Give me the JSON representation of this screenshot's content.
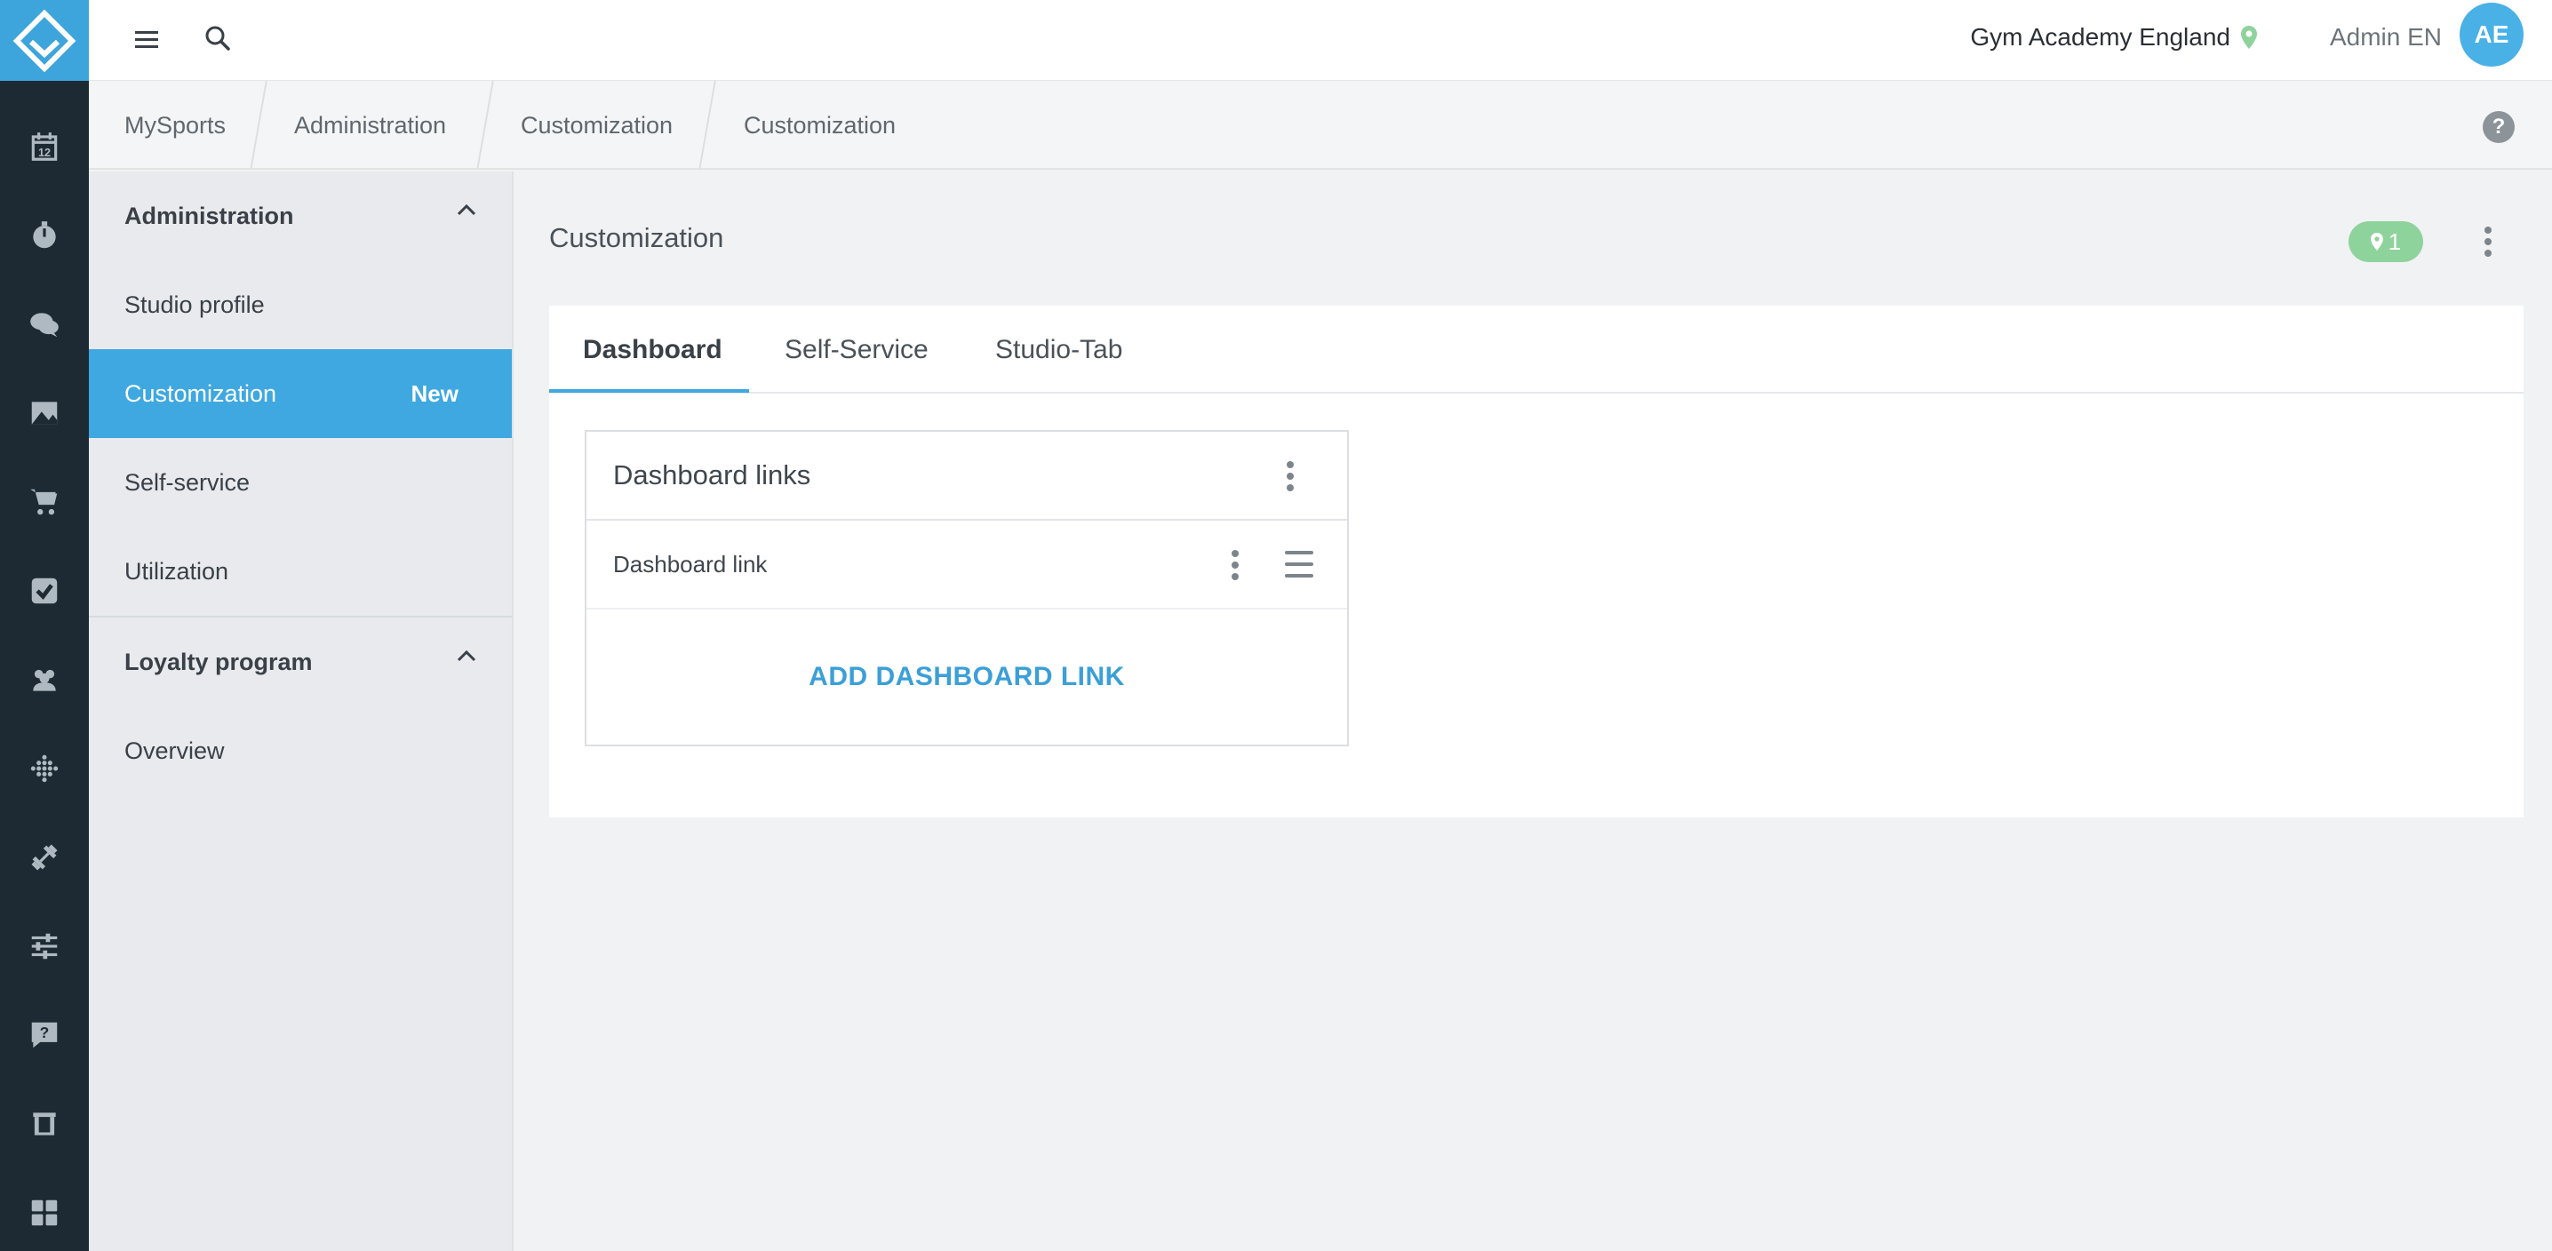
{
  "header": {
    "studio_name": "Gym Academy England",
    "user_name": "Admin EN",
    "avatar_initials": "AE"
  },
  "rail": {
    "icons": [
      "calendar-icon",
      "timer-icon",
      "chat-icon",
      "image-icon",
      "cart-icon",
      "checkbox-icon",
      "users-icon",
      "dots-grid-icon",
      "dumbbell-icon",
      "sliders-icon",
      "help-chat-icon",
      "store-icon",
      "dashboard-icon"
    ],
    "calendar_day": "12"
  },
  "breadcrumb": [
    "MySports",
    "Administration",
    "Customization",
    "Customization"
  ],
  "help_label": "?",
  "sidebar": {
    "sections": [
      {
        "title": "Administration",
        "items": [
          {
            "label": "Studio profile",
            "badge": ""
          },
          {
            "label": "Customization",
            "badge": "New"
          },
          {
            "label": "Self-service",
            "badge": ""
          },
          {
            "label": "Utilization",
            "badge": ""
          }
        ]
      },
      {
        "title": "Loyalty program",
        "items": [
          {
            "label": "Overview",
            "badge": ""
          }
        ]
      }
    ]
  },
  "main": {
    "title": "Customization",
    "location_count": "1",
    "tabs": [
      "Dashboard",
      "Self-Service",
      "Studio-Tab"
    ],
    "active_tab": "Dashboard",
    "card": {
      "title": "Dashboard links",
      "rows": [
        "Dashboard link"
      ],
      "add_label": "ADD DASHBOARD LINK"
    }
  },
  "colors": {
    "brand": "#3da5dc",
    "rail_bg": "#1d2a33",
    "active_item": "#3fa8e0",
    "location_badge": "#8fd39c",
    "link": "#3b9fd8"
  }
}
